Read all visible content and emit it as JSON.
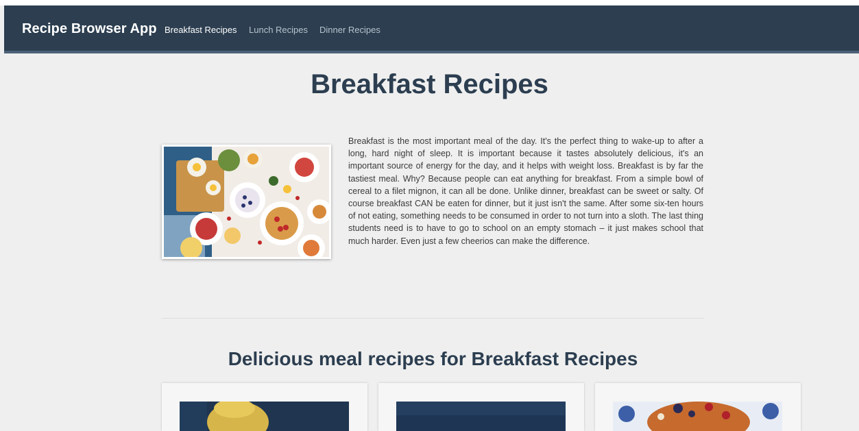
{
  "navbar": {
    "brand": "Recipe Browser App",
    "links": [
      {
        "label": "Breakfast Recipes",
        "active": true
      },
      {
        "label": "Lunch Recipes",
        "active": false
      },
      {
        "label": "Dinner Recipes",
        "active": false
      }
    ]
  },
  "page": {
    "title": "Breakfast Recipes",
    "intro": "Breakfast is the most important meal of the day. It's the perfect thing to wake-up to after a long, hard night of sleep. It is important because it tastes absolutely delicious, it's an important source of energy for the day, and it helps with weight loss. Breakfast is by far the tastiest meal. Why? Because people can eat anything for breakfast. From a simple bowl of cereal to a filet mignon, it can all be done. Unlike dinner, breakfast can be sweet or salty. Of course breakfast CAN be eaten for dinner, but it just isn't the same. After some six-ten hours of not eating, something needs to be consumed in order to not turn into a sloth. The last thing students need is to have to go to school on an empty stomach – it just makes school that much harder. Even just a few cheerios can make the difference.",
    "section_title": "Delicious meal recipes for Breakfast Recipes"
  },
  "colors": {
    "navbar": "#2c3e50",
    "title": "#2c3e50",
    "background": "#efefef"
  }
}
